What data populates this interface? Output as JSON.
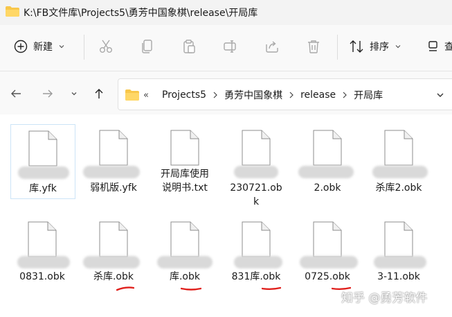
{
  "window": {
    "title": "K:\\FB文件库\\Projects5\\勇芳中国象棋\\release\\开局库"
  },
  "toolbar": {
    "new_label": "新建",
    "sort_label": "排序",
    "view_label": "查"
  },
  "address": {
    "overflow": "«",
    "crumbs": [
      "Projects5",
      "勇芳中国象棋",
      "release",
      "开局库"
    ]
  },
  "files": [
    {
      "name": "库.yfk"
    },
    {
      "name": "弱机版.yfk"
    },
    {
      "name": "开局库使用说明书.txt"
    },
    {
      "name": "230721.obk"
    },
    {
      "name": "2.obk"
    },
    {
      "name": "杀库2.obk"
    },
    {
      "name": "0831.obk"
    },
    {
      "name": "杀库.obk"
    },
    {
      "name": "库.obk"
    },
    {
      "name": "831库.obk"
    },
    {
      "name": "0725.obk"
    },
    {
      "name": "3-11.obk"
    }
  ],
  "watermark": "知乎 @勇芳软件",
  "colors": {
    "accent": "#1a73d9",
    "folder": "#f8c74a",
    "red_underline": "#e0201c"
  },
  "icons": [
    "plus-circle-icon",
    "cut-icon",
    "copy-icon",
    "paste-icon",
    "rename-icon",
    "share-icon",
    "delete-icon",
    "sort-icon",
    "view-icon",
    "back-arrow-icon",
    "forward-arrow-icon",
    "chevron-down-icon",
    "up-arrow-icon",
    "folder-icon",
    "document-icon"
  ]
}
